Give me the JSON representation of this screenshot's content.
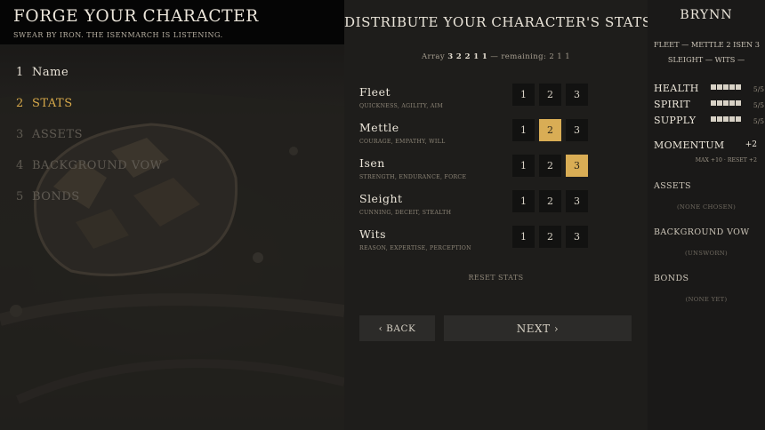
{
  "left": {
    "title": "Forge your Character",
    "subtitle": "Swear by iron. The Isenmarch is listening.",
    "steps": [
      {
        "num": "1",
        "label": "Name"
      },
      {
        "num": "2",
        "label": "Stats"
      },
      {
        "num": "3",
        "label": "Assets"
      },
      {
        "num": "4",
        "label": "Background Vow"
      },
      {
        "num": "5",
        "label": "Bonds"
      }
    ]
  },
  "center": {
    "title": "Distribute your character's stats.",
    "array_prefix": "Array",
    "array_values": "3 2 2 1 1",
    "array_mid": "— remaining:",
    "array_remaining": "2 1 1",
    "stats": [
      {
        "name": "Fleet",
        "desc": "quickness, agility, aim",
        "options": [
          "1",
          "2",
          "3"
        ],
        "selected": null
      },
      {
        "name": "Mettle",
        "desc": "courage, empathy, will",
        "options": [
          "1",
          "2",
          "3"
        ],
        "selected": "2"
      },
      {
        "name": "Isen",
        "desc": "strength, endurance, force",
        "options": [
          "1",
          "2",
          "3"
        ],
        "selected": "3"
      },
      {
        "name": "Sleight",
        "desc": "cunning, deceit, stealth",
        "options": [
          "1",
          "2",
          "3"
        ],
        "selected": null
      },
      {
        "name": "Wits",
        "desc": "reason, expertise, perception",
        "options": [
          "1",
          "2",
          "3"
        ],
        "selected": null
      }
    ],
    "reset_label": "reset stats",
    "back_label": "‹ Back",
    "next_label": "Next ›"
  },
  "right": {
    "name": "BRYNN",
    "summary_line1": "Fleet — Mettle 2   Isen 3",
    "summary_line2": "Sleight —   Wits —",
    "meters": [
      {
        "name": "Health",
        "value": "5/5",
        "filled": 5,
        "max": 5
      },
      {
        "name": "Spirit",
        "value": "5/5",
        "filled": 5,
        "max": 5
      },
      {
        "name": "Supply",
        "value": "5/5",
        "filled": 5,
        "max": 5
      }
    ],
    "momentum_label": "Momentum",
    "momentum_value": "+2",
    "momentum_sub": "max +10 · reset +2",
    "assets_title": "Assets",
    "assets_empty": "(none chosen)",
    "vow_title": "Background Vow",
    "vow_empty": "(unsworn)",
    "bonds_title": "Bonds",
    "bonds_empty": "(none yet)"
  },
  "colors": {
    "accent": "#d9ad55",
    "active_step": "#d7a94a",
    "pending_step": "#5f5a52",
    "header_bg": "#050505"
  },
  "icons": [
    "chevron-left-icon",
    "chevron-right-icon"
  ]
}
